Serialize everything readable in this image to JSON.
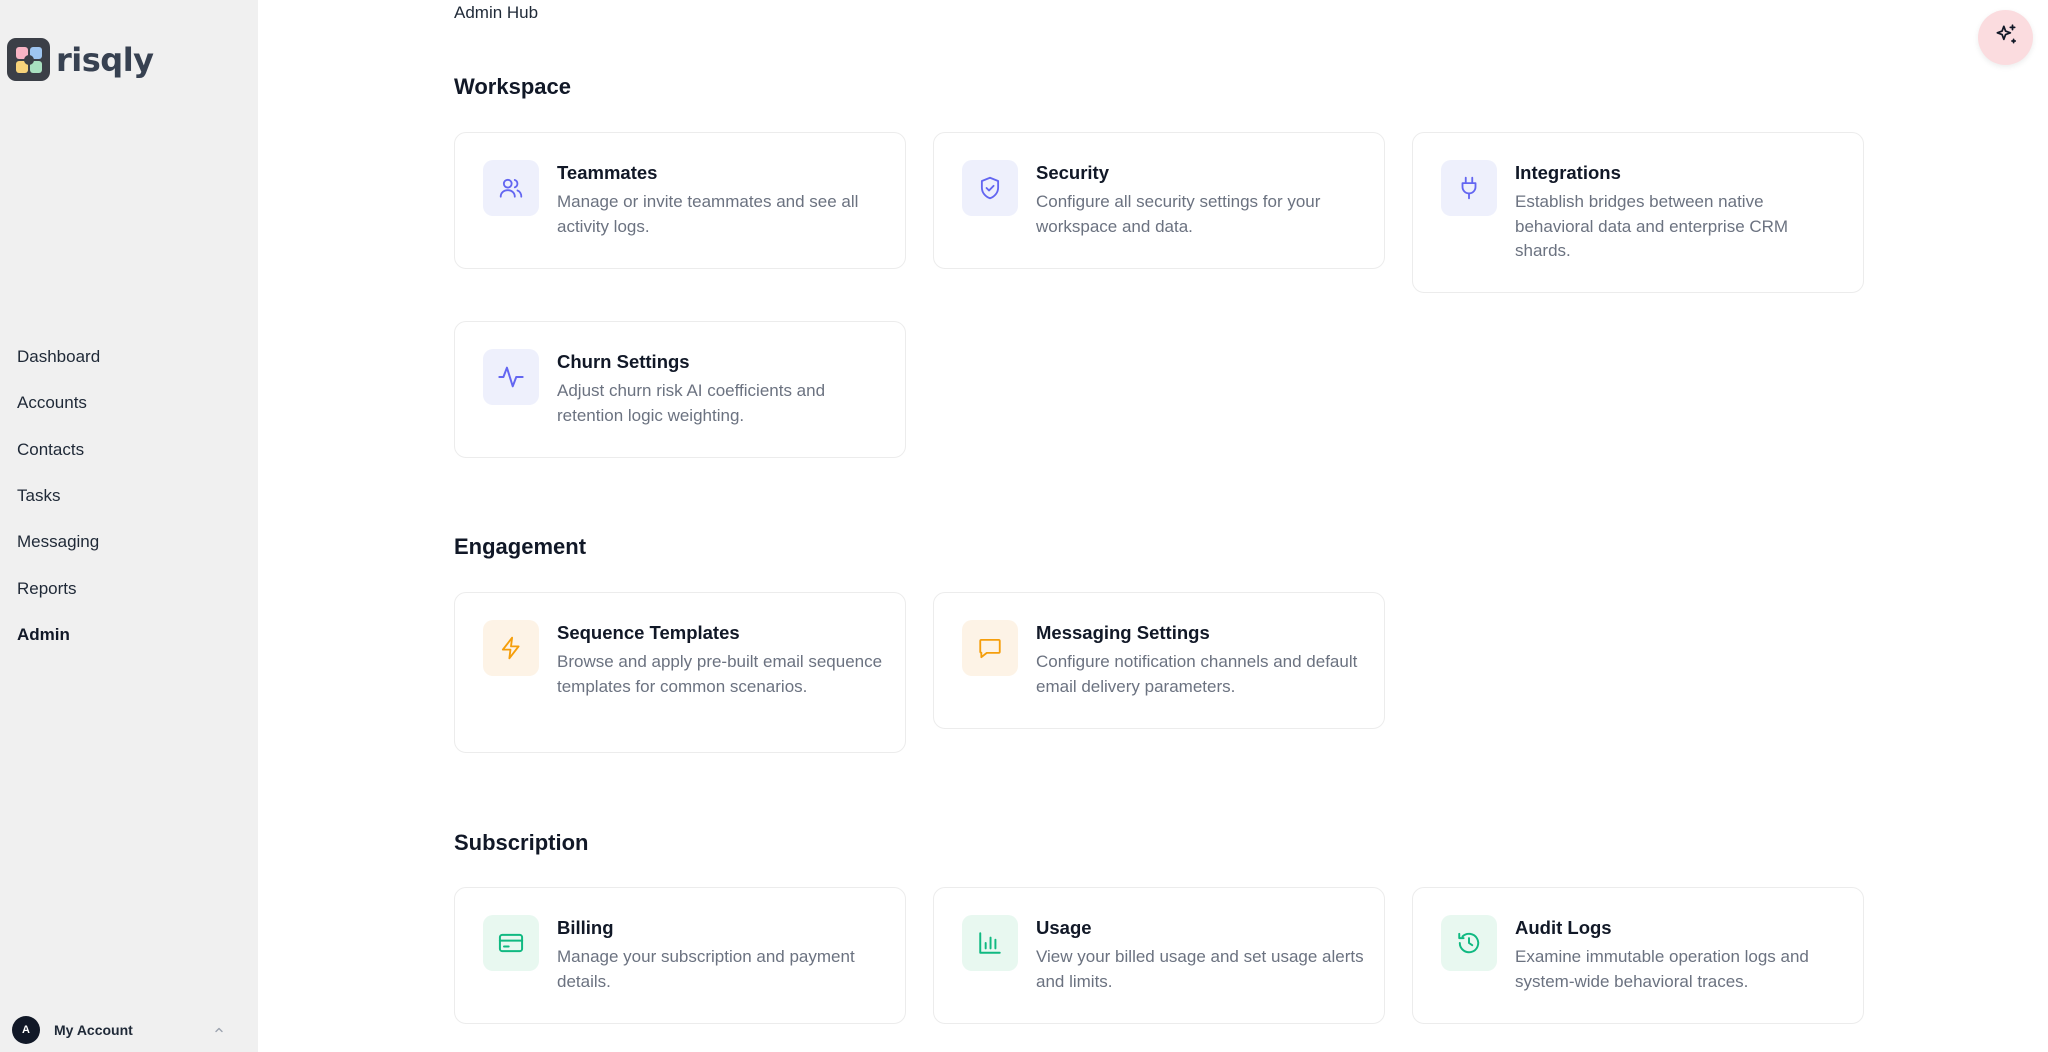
{
  "brand": {
    "name": "risqly"
  },
  "sidebar": {
    "items": [
      {
        "label": "Dashboard"
      },
      {
        "label": "Accounts"
      },
      {
        "label": "Contacts"
      },
      {
        "label": "Tasks"
      },
      {
        "label": "Messaging"
      },
      {
        "label": "Reports"
      },
      {
        "label": "Admin",
        "active": true
      }
    ],
    "account": {
      "avatar_initial": "A",
      "label": "My Account"
    }
  },
  "main": {
    "breadcrumb": "Admin Hub",
    "sections": [
      {
        "title": "Workspace",
        "cards": [
          {
            "title": "Teammates",
            "description": "Manage or invite teammates and see all activity logs.",
            "icon": "users-icon"
          },
          {
            "title": "Security",
            "description": "Configure all security settings for your workspace and data.",
            "icon": "shield-check-icon"
          },
          {
            "title": "Integrations",
            "description": "Establish bridges between native behavioral data and enterprise CRM shards.",
            "icon": "plug-icon"
          },
          {
            "title": "Churn Settings",
            "description": "Adjust churn risk AI coefficients and retention logic weighting.",
            "icon": "activity-icon"
          }
        ]
      },
      {
        "title": "Engagement",
        "cards": [
          {
            "title": "Sequence Templates",
            "description": "Browse and apply pre-built email sequence templates for common scenarios.",
            "icon": "lightning-icon"
          },
          {
            "title": "Messaging Settings",
            "description": "Configure notification channels and default email delivery parameters.",
            "icon": "message-square-icon"
          }
        ]
      },
      {
        "title": "Subscription",
        "cards": [
          {
            "title": "Billing",
            "description": "Manage your subscription and payment details.",
            "icon": "credit-card-icon"
          },
          {
            "title": "Usage",
            "description": "View your billed usage and set usage alerts and limits.",
            "icon": "bar-chart-icon"
          },
          {
            "title": "Audit Logs",
            "description": "Examine immutable operation logs and system-wide behavioral traces.",
            "icon": "history-icon"
          }
        ]
      }
    ]
  },
  "colors": {
    "purple_accent": "#6366f1",
    "orange_accent": "#f59e0b",
    "green_accent": "#10b981",
    "ai_button_bg": "#fbdcdf"
  }
}
